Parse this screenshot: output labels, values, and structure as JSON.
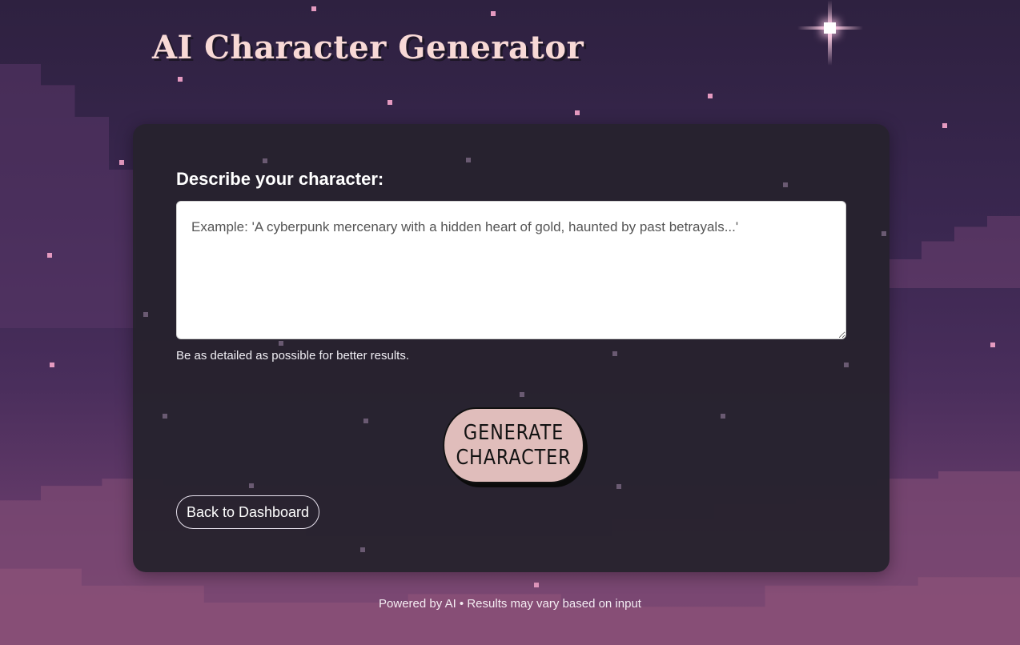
{
  "header": {
    "title": "AI Character Generator"
  },
  "form": {
    "label": "Describe your character:",
    "placeholder": "Example: 'A cyberpunk mercenary with a hidden heart of gold, haunted by past betrayals...'",
    "hint": "Be as detailed as possible for better results.",
    "generate_label": "GENERATE CHARACTER",
    "back_label": "Back to Dashboard"
  },
  "footer": {
    "text": "Powered by AI • Results may vary based on input"
  },
  "colors": {
    "background": "#3a2750",
    "card": "#26222e",
    "title": "#f8d9d6",
    "button": "#e0bdbb",
    "star": "#e59ac0"
  }
}
